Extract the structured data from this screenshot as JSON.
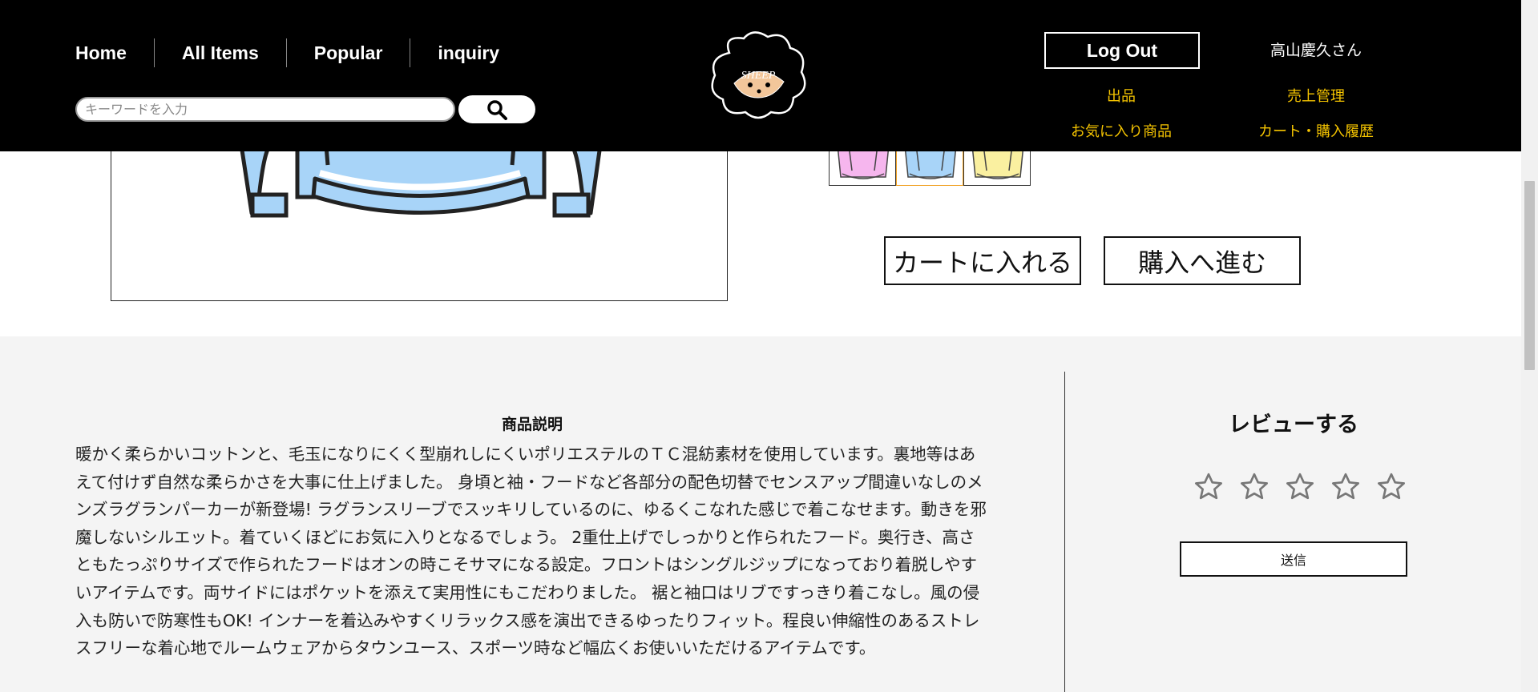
{
  "header": {
    "nav": {
      "home": "Home",
      "all_items": "All Items",
      "popular": "Popular",
      "inquiry": "inquiry"
    },
    "search": {
      "placeholder": "キーワードを入力"
    },
    "logo_text": "SHEEP",
    "logout_label": "Log Out",
    "user_name": "高山慶久さん",
    "links": {
      "listing": "出品",
      "sales": "売上管理",
      "favorites": "お気に入り商品",
      "cart_history": "カート・購入履歴"
    }
  },
  "product": {
    "color_options": [
      "pink",
      "blue",
      "yellow"
    ],
    "selected_color": "blue",
    "colors": {
      "pink": "#f6b6ee",
      "blue": "#a8d4f8",
      "yellow": "#faf0a0",
      "selected_border": "#f0a020"
    },
    "add_to_cart_label": "カートに入れる",
    "buy_now_label": "購入へ進む"
  },
  "description": {
    "title": "商品説明",
    "text": "暖かく柔らかいコットンと、毛玉になりにくく型崩れしにくいポリエステルのＴＣ混紡素材を使用しています。裏地等はあえて付けず自然な柔らかさを大事に仕上げました。 身頃と袖・フードなど各部分の配色切替でセンスアップ間違いなしのメンズラグランパーカーが新登場! ラグランスリーブでスッキリしているのに、ゆるくこなれた感じで着こなせます。動きを邪魔しないシルエット。着ていくほどにお気に入りとなるでしょう。 2重仕上げでしっかりと作られたフード。奥行き、高さともたっぷりサイズで作られたフードはオンの時こそサマになる設定。フロントはシングルジップになっており着脱しやすいアイテムです。両サイドにはポケットを添えて実用性にもこだわりました。 裾と袖口はリブですっきり着こなし。風の侵入も防いで防寒性もOK! インナーを着込みやすくリラックス感を演出できるゆったりフィット。程良い伸縮性のあるストレスフリーな着心地でルームウェアからタウンユース、スポーツ時など幅広くお使いいただけるアイテムです。"
  },
  "review": {
    "title": "レビューする",
    "rating": 0,
    "max_rating": 5,
    "submit_label": "送信"
  },
  "theme": {
    "header_bg": "#000000",
    "link_color": "#f5c400",
    "section_bg": "#f4f4f4"
  }
}
